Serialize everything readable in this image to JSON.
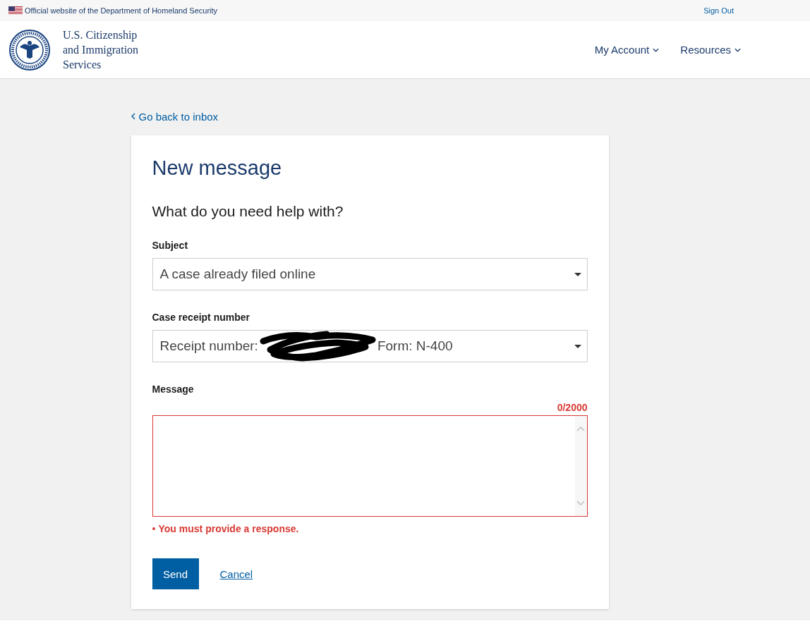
{
  "banner": {
    "text": "Official website of the Department of Homeland Security",
    "link": "Sign Out"
  },
  "header": {
    "agency_lines": [
      "U.S. Citizenship",
      "and Immigration",
      "Services"
    ],
    "nav": [
      {
        "label": "My Account"
      },
      {
        "label": "Resources"
      }
    ]
  },
  "back_link": "Go back to inbox",
  "form": {
    "title": "New message",
    "question": "What do you need help with?",
    "subject": {
      "label": "Subject",
      "value": "A case already filed online"
    },
    "receipt": {
      "label": "Case receipt number",
      "value_start": "Receipt number:",
      "value_end": "Form: N-400",
      "redacted": true
    },
    "message": {
      "label": "Message",
      "counter": "0/2000",
      "error": true,
      "error_text": "You must provide a response."
    },
    "buttons": {
      "send": "Send",
      "cancel": "Cancel"
    }
  }
}
